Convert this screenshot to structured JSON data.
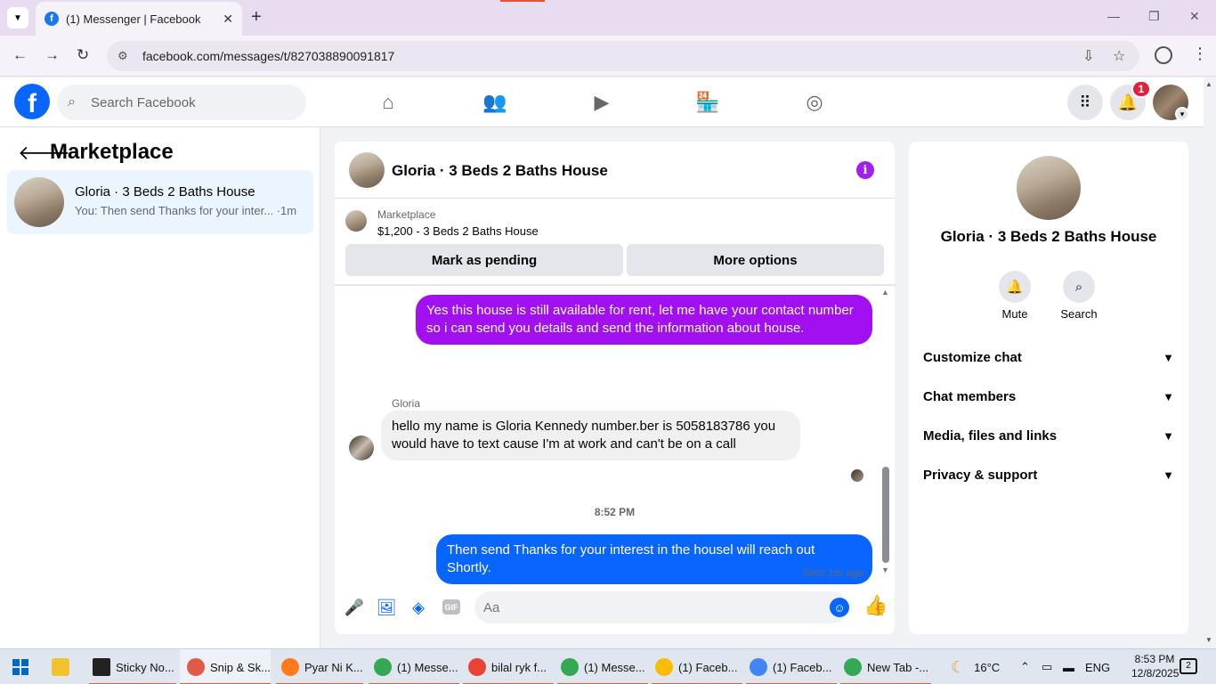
{
  "browser": {
    "tab_title": "(1) Messenger | Facebook",
    "url": "facebook.com/messages/t/827038890091817"
  },
  "facebook": {
    "search_placeholder": "Search Facebook",
    "notification_count": "1"
  },
  "left_panel": {
    "title": "Marketplace",
    "conversation": {
      "name": "Gloria · 3 Beds 2 Baths House",
      "preview": "You: Then send Thanks for your inter...",
      "time": "·1m"
    }
  },
  "chat": {
    "title": "Gloria · 3 Beds 2 Baths House",
    "marketplace_label": "Marketplace",
    "listing": "$1,200 - 3 Beds 2 Baths House",
    "mark_pending": "Mark as pending",
    "more_options": "More options",
    "messages": [
      {
        "sender": "me",
        "text": "Yes this house is still available for rent, let me have your contact number so i can send you details and send the information about house."
      },
      {
        "sender": "Gloria",
        "text": "hello my name is Gloria Kennedy number.ber is 5058183786 you would have to text cause I'm at work and can't be on a call"
      },
      {
        "sender": "me",
        "text": "Then send Thanks for your interest in the housel will reach out Shortly."
      }
    ],
    "timestamp": "8:52 PM",
    "sent_status": "Sent 1m ago",
    "input_placeholder": "Aa"
  },
  "right_panel": {
    "name": "Gloria · 3 Beds 2 Baths House",
    "mute_label": "Mute",
    "search_label": "Search",
    "sections": [
      "Customize chat",
      "Chat members",
      "Media, files and links",
      "Privacy & support"
    ]
  },
  "taskbar": {
    "items": [
      "Sticky No...",
      "Snip & Sk...",
      "Pyar Ni K...",
      "(1) Messe...",
      "bilal ryk f...",
      "(1) Messe...",
      "(1) Faceb...",
      "(1) Faceb...",
      "New Tab -..."
    ],
    "weather": "16°C",
    "language": "ENG",
    "time": "8:53 PM",
    "date": "12/8/2025",
    "notifications": "2"
  },
  "colors": {
    "facebook_blue": "#0866ff",
    "purple_bubble": "#a20ff0",
    "selected_conv": "#ebf5ff"
  }
}
